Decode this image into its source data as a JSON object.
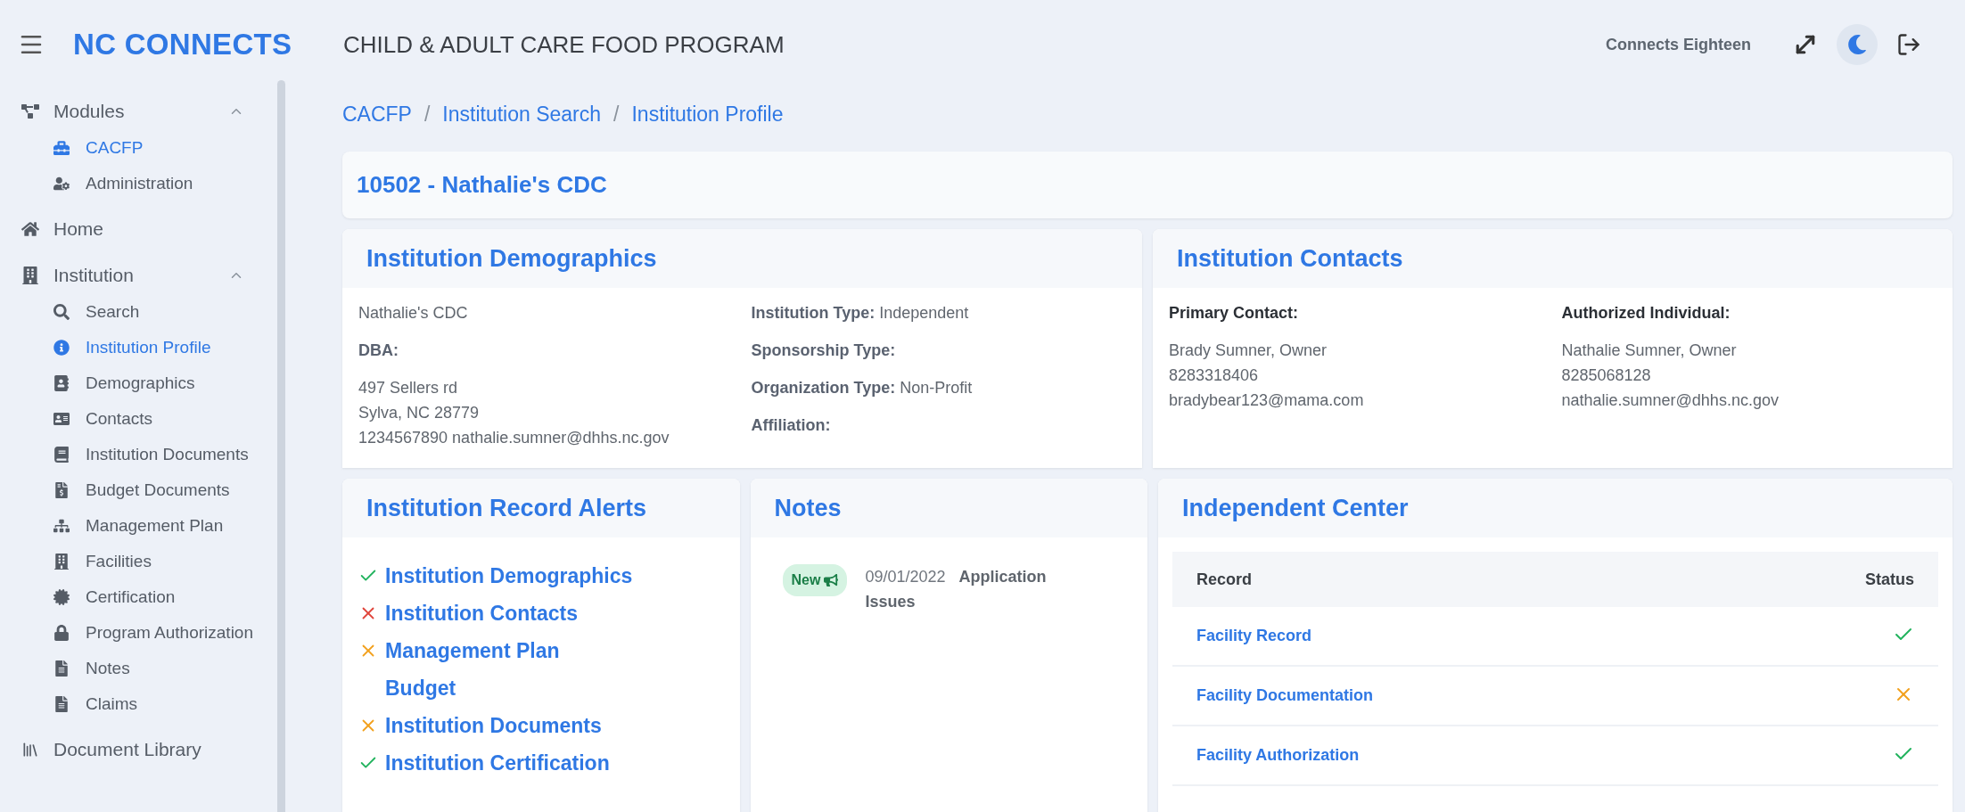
{
  "header": {
    "brand": "NC CONNECTS",
    "app_title": "CHILD & ADULT CARE FOOD PROGRAM",
    "user": "Connects Eighteen"
  },
  "sidebar": {
    "items": [
      {
        "label": "Modules",
        "selected": false,
        "expanded": true,
        "children": [
          {
            "label": "CACFP",
            "selected": true
          },
          {
            "label": "Administration",
            "selected": false
          }
        ]
      },
      {
        "label": "Home",
        "selected": false
      },
      {
        "label": "Institution",
        "selected": false,
        "expanded": true,
        "children": [
          {
            "label": "Search",
            "selected": false
          },
          {
            "label": "Institution Profile",
            "selected": true
          },
          {
            "label": "Demographics",
            "selected": false
          },
          {
            "label": "Contacts",
            "selected": false
          },
          {
            "label": "Institution Documents",
            "selected": false
          },
          {
            "label": "Budget Documents",
            "selected": false
          },
          {
            "label": "Management Plan",
            "selected": false
          },
          {
            "label": "Facilities",
            "selected": false
          },
          {
            "label": "Certification",
            "selected": false
          },
          {
            "label": "Program Authorization",
            "selected": false
          },
          {
            "label": "Notes",
            "selected": false
          },
          {
            "label": "Claims",
            "selected": false
          }
        ]
      },
      {
        "label": "Document Library",
        "selected": false
      }
    ]
  },
  "breadcrumb": {
    "separator": "/",
    "links": [
      "CACFP",
      "Institution Search",
      "Institution Profile"
    ]
  },
  "page_title": "10502 - Nathalie's CDC",
  "demographics": {
    "title": "Institution Demographics",
    "name": "Nathalie's CDC",
    "dba_label": "DBA:",
    "address": [
      "497 Sellers rd",
      "Sylva, NC 28779",
      "1234567890 nathalie.sumner@dhhs.nc.gov"
    ],
    "fields": [
      {
        "label": "Institution Type:",
        "value": "Independent"
      },
      {
        "label": "Sponsorship Type:"
      },
      {
        "label": "Organization Type:",
        "value": "Non-Profit"
      },
      {
        "label": "Affiliation:"
      }
    ]
  },
  "contacts": {
    "title": "Institution Contacts",
    "columns": [
      {
        "label": "Primary Contact:",
        "lines": [
          "Brady Sumner, Owner",
          "8283318406",
          "bradybear123@mama.com"
        ]
      },
      {
        "label": "Authorized Individual:",
        "lines": [
          "Nathalie Sumner, Owner",
          "8285068128",
          "nathalie.sumner@dhhs.nc.gov"
        ]
      }
    ]
  },
  "alerts": {
    "title": "Institution Record Alerts",
    "items": [
      {
        "label": "Institution Demographics",
        "kind": "ok"
      },
      {
        "label": "Institution Contacts",
        "kind": "error"
      },
      {
        "label": "Management Plan",
        "kind": "warning"
      },
      {
        "label": "Budget",
        "kind": "none"
      },
      {
        "label": "Institution Documents",
        "kind": "warning"
      },
      {
        "label": "Institution Certification",
        "kind": "ok"
      }
    ]
  },
  "notes": {
    "title": "Notes",
    "items": [
      {
        "badge": "New",
        "date": "09/01/2022",
        "subject": "Application Issues"
      }
    ]
  },
  "center": {
    "title": "Independent Center",
    "columns": [
      "Record",
      "Status"
    ],
    "rows": [
      {
        "record": "Facility Record",
        "kind": "ok"
      },
      {
        "record": "Facility Documentation",
        "kind": "warning"
      },
      {
        "record": "Facility Authorization",
        "kind": "ok"
      }
    ]
  }
}
